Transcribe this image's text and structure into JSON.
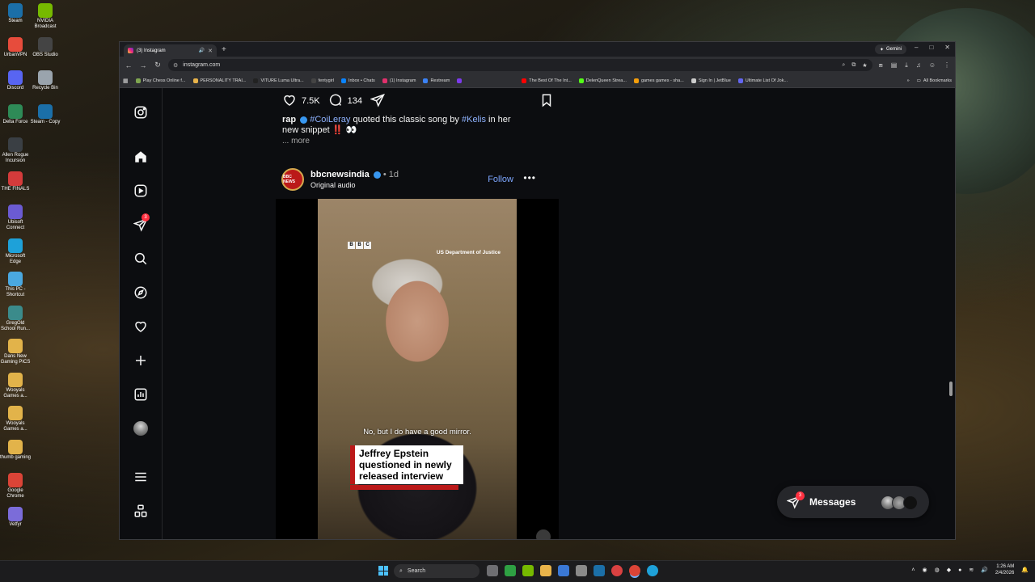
{
  "desktop": {
    "icons": [
      {
        "label": "Steam",
        "color": "#1b6fa8"
      },
      {
        "label": "NVIDIA Broadcast",
        "color": "#76b900"
      },
      {
        "label": "UrbanVPN",
        "color": "#e74c3c"
      },
      {
        "label": "OBS Studio",
        "color": "#444444"
      },
      {
        "label": "Discord",
        "color": "#5865f2"
      },
      {
        "label": "Recycle Bin",
        "color": "#9aa4ad"
      },
      {
        "label": "Delta Force",
        "color": "#2e8b57"
      },
      {
        "label": "Steam - Copy",
        "color": "#1b6fa8"
      },
      {
        "label": "Allen Rogue Incursion",
        "color": "#3a3f44"
      },
      {
        "label": "THE FINALS",
        "color": "#d43b3b"
      },
      {
        "label": "Ubisoft Connect",
        "color": "#6b5bd2"
      },
      {
        "label": "Microsoft Edge",
        "color": "#1ea1d9"
      },
      {
        "label": "This PC - Shortcut",
        "color": "#4aa8e0"
      },
      {
        "label": "GregOld School Run...",
        "color": "#3b8b8b"
      },
      {
        "label": "Dans New Gaming PICS",
        "color": "#e2b34a"
      },
      {
        "label": "Wooyals Games a...",
        "color": "#e2b34a"
      },
      {
        "label": "Wooyals Games a...",
        "color": "#e2b34a"
      },
      {
        "label": "thumb gaming",
        "color": "#e2b34a"
      },
      {
        "label": "Google Chrome",
        "color": "#db4437"
      },
      {
        "label": "Vetfyr",
        "color": "#7b6cd9"
      }
    ]
  },
  "browser": {
    "tab_title": "(3) Instagram",
    "new_tab": "+",
    "gemini": "Gemini",
    "url": "instagram.com",
    "window_controls": [
      "–",
      "□",
      "✕"
    ],
    "bookmarks": [
      {
        "label": "Play Chess Online f...",
        "color": "#7fa650"
      },
      {
        "label": "PERSONALITY TRAI...",
        "color": "#e8b34a"
      },
      {
        "label": "VITURE Luma Ultra...",
        "color": "#222222"
      },
      {
        "label": "fentygirl",
        "color": "#444444"
      },
      {
        "label": "Inbox • Chats",
        "color": "#0a84ff"
      },
      {
        "label": "(1) Instagram",
        "color": "#e1306c"
      },
      {
        "label": "Restream",
        "color": "#3b82f6"
      },
      {
        "label": "",
        "color": "#7c3aed"
      },
      {
        "label": "The Best Of The Int...",
        "color": "#ff0000"
      },
      {
        "label": "DelenQueen Strea...",
        "color": "#53fc18"
      },
      {
        "label": "games games - sha...",
        "color": "#f59e0b"
      },
      {
        "label": "Sign In | JetBlue",
        "color": "#cccccc"
      },
      {
        "label": "Ultimate List Of Jok...",
        "color": "#6366f1"
      }
    ],
    "all_bookmarks": "All Bookmarks"
  },
  "instagram": {
    "nav_badge": "3",
    "prev_post": {
      "likes": "7.5K",
      "comments": "134",
      "caption_user": "rap",
      "caption_tag1": "#CoiLeray",
      "caption_mid": "quoted this classic song by",
      "caption_tag2": "#Kelis",
      "caption_end": "in her new snippet ‼️ 👀",
      "more": "... more"
    },
    "post": {
      "avatar_text": "BBC NEWS",
      "username": "bbcnewsindia",
      "time": "• 1d",
      "audio": "Original audio",
      "follow": "Follow",
      "menu": "•••",
      "video": {
        "bbc_letters": [
          "B",
          "B",
          "C"
        ],
        "source": "US Department of Justice",
        "subtitle": "No, but I do have a good mirror.",
        "headline": "Jeffrey Epstein questioned in newly released interview"
      }
    },
    "messages": {
      "label": "Messages",
      "badge": "3"
    }
  },
  "taskbar": {
    "search": "Search",
    "time": "1:26 AM",
    "date": "2/4/2026"
  }
}
